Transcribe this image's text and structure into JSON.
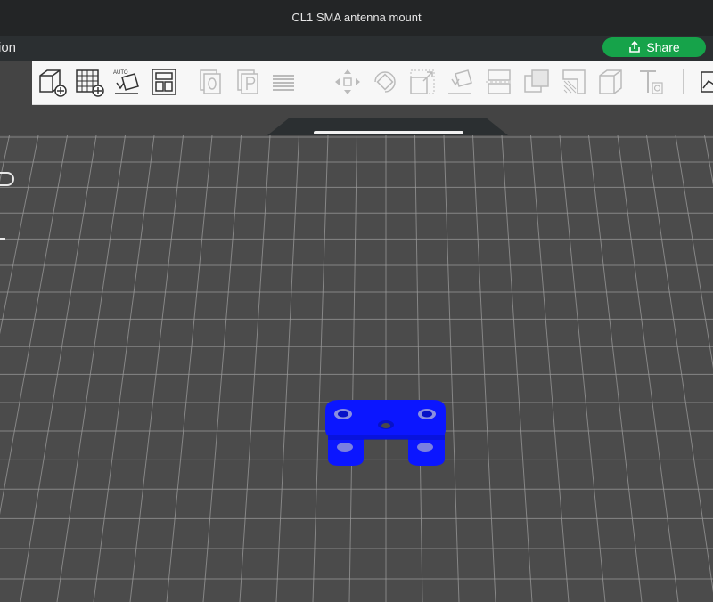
{
  "window": {
    "title": "CL1 SMA antenna mount"
  },
  "menu": {
    "visible_label": "ion"
  },
  "share_button": {
    "label": "Share"
  },
  "toolbar": {
    "tools": [
      "add-object-icon",
      "add-plate-icon",
      "auto-orient-icon",
      "arrange-icon",
      "copy-icon",
      "paste-icon",
      "layers-icon",
      "move-icon",
      "rotate-icon",
      "scale-icon",
      "lay-on-face-icon",
      "cut-icon",
      "boolean-icon",
      "support-paint-icon",
      "seam-paint-icon",
      "variable-layer-icon",
      "text-icon",
      "measure-icon"
    ],
    "auto_label": "AUTO"
  },
  "colors": {
    "titlebar": "#232526",
    "menubar": "#2b2f31",
    "toolbar": "#f7f7f7",
    "viewport_bg": "#4b4b4b",
    "grid_line": "#9a9a9a",
    "model": "#0b16ff",
    "share": "#16a34a"
  }
}
